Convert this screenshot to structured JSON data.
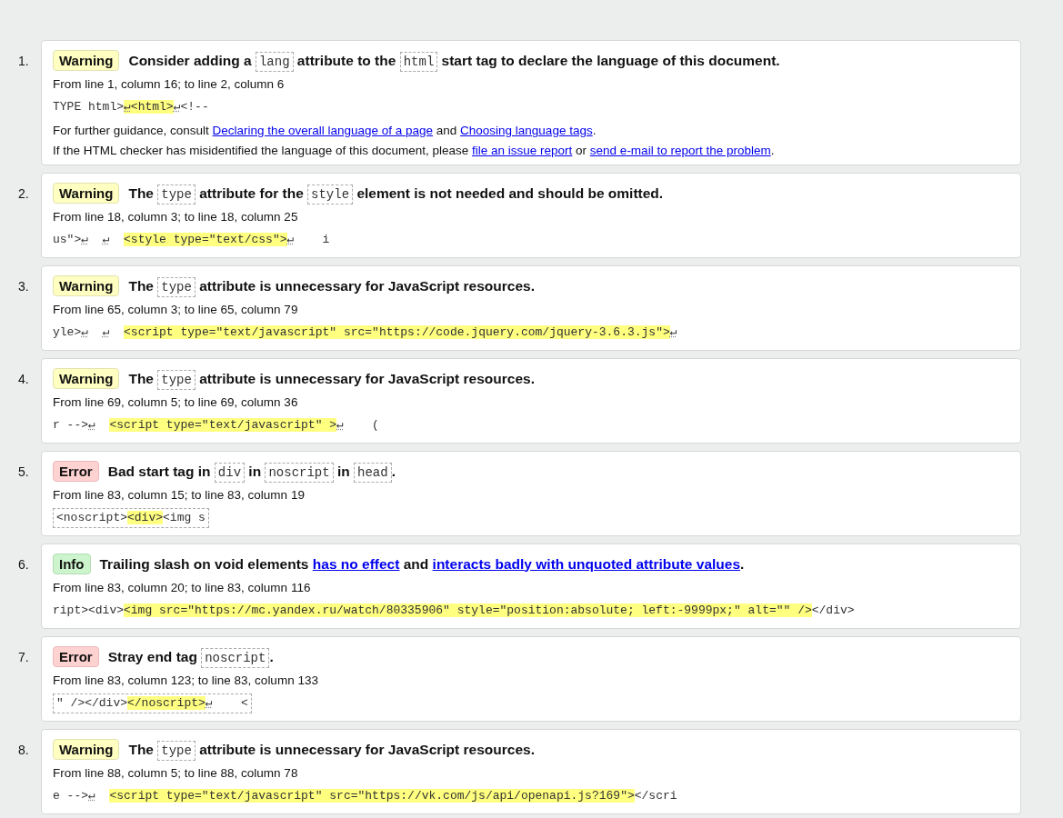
{
  "messages": [
    {
      "number": "1.",
      "kind": "warning",
      "badge": "Warning",
      "title": [
        {
          "kind": "text",
          "text": "Consider adding a "
        },
        {
          "kind": "code",
          "text": "lang"
        },
        {
          "kind": "text",
          "text": " attribute to the "
        },
        {
          "kind": "code",
          "text": "html"
        },
        {
          "kind": "text",
          "text": " start tag to declare the language of this document."
        }
      ],
      "location": "From line 1, column 16; to line 2, column 6",
      "extract": {
        "boxed": false,
        "parts": [
          {
            "kind": "text",
            "text": "TYPE html>",
            "highlight": false
          },
          {
            "kind": "lf",
            "text": "↵",
            "highlight": true
          },
          {
            "kind": "text",
            "text": "<html>",
            "highlight": true
          },
          {
            "kind": "lf",
            "text": "↵",
            "highlight": false
          },
          {
            "kind": "text",
            "text": "<!--",
            "highlight": false
          }
        ]
      },
      "notes": [
        [
          {
            "kind": "text",
            "text": "For further guidance, consult "
          },
          {
            "kind": "link",
            "text": "Declaring the overall language of a page"
          },
          {
            "kind": "text",
            "text": " and "
          },
          {
            "kind": "link",
            "text": "Choosing language tags"
          },
          {
            "kind": "text",
            "text": "."
          }
        ],
        [
          {
            "kind": "text",
            "text": "If the HTML checker has misidentified the language of this document, please "
          },
          {
            "kind": "link",
            "text": "file an issue report"
          },
          {
            "kind": "text",
            "text": " or "
          },
          {
            "kind": "link",
            "text": "send e-mail to report the problem"
          },
          {
            "kind": "text",
            "text": "."
          }
        ]
      ]
    },
    {
      "number": "2.",
      "kind": "warning",
      "badge": "Warning",
      "title": [
        {
          "kind": "text",
          "text": "The "
        },
        {
          "kind": "code",
          "text": "type"
        },
        {
          "kind": "text",
          "text": " attribute for the "
        },
        {
          "kind": "code",
          "text": "style"
        },
        {
          "kind": "text",
          "text": " element is not needed and should be omitted."
        }
      ],
      "location": "From line 18, column 3; to line 18, column 25",
      "extract": {
        "boxed": false,
        "parts": [
          {
            "kind": "text",
            "text": "us\">",
            "highlight": false
          },
          {
            "kind": "lf",
            "text": "↵",
            "highlight": false
          },
          {
            "kind": "lf",
            "text": "↵",
            "highlight": false
          },
          {
            "kind": "text",
            "text": "<style type=\"text/css\">",
            "highlight": true
          },
          {
            "kind": "lf",
            "text": "↵",
            "highlight": false
          },
          {
            "kind": "text",
            "text": "    i",
            "highlight": false
          }
        ]
      }
    },
    {
      "number": "3.",
      "kind": "warning",
      "badge": "Warning",
      "title": [
        {
          "kind": "text",
          "text": "The "
        },
        {
          "kind": "code",
          "text": "type"
        },
        {
          "kind": "text",
          "text": " attribute is unnecessary for JavaScript resources."
        }
      ],
      "location": "From line 65, column 3; to line 65, column 79",
      "extract": {
        "boxed": false,
        "parts": [
          {
            "kind": "text",
            "text": "yle>",
            "highlight": false
          },
          {
            "kind": "lf",
            "text": "↵",
            "highlight": false
          },
          {
            "kind": "lf",
            "text": "↵",
            "highlight": false
          },
          {
            "kind": "text",
            "text": "<script type=\"text/javascript\" src=\"https://code.jquery.com/jquery-3.6.3.js\">",
            "highlight": true
          },
          {
            "kind": "lf",
            "text": "↵",
            "highlight": false
          }
        ]
      }
    },
    {
      "number": "4.",
      "kind": "warning",
      "badge": "Warning",
      "title": [
        {
          "kind": "text",
          "text": "The "
        },
        {
          "kind": "code",
          "text": "type"
        },
        {
          "kind": "text",
          "text": " attribute is unnecessary for JavaScript resources."
        }
      ],
      "location": "From line 69, column 5; to line 69, column 36",
      "extract": {
        "boxed": false,
        "parts": [
          {
            "kind": "text",
            "text": "r -->",
            "highlight": false
          },
          {
            "kind": "lf",
            "text": "↵",
            "highlight": false
          },
          {
            "kind": "text",
            "text": "<script type=\"text/javascript\" >",
            "highlight": true
          },
          {
            "kind": "lf",
            "text": "↵",
            "highlight": false
          },
          {
            "kind": "text",
            "text": "    (",
            "highlight": false
          }
        ]
      }
    },
    {
      "number": "5.",
      "kind": "error",
      "badge": "Error",
      "title": [
        {
          "kind": "text",
          "text": "Bad start tag in "
        },
        {
          "kind": "code",
          "text": "div"
        },
        {
          "kind": "text",
          "text": " in "
        },
        {
          "kind": "code",
          "text": "noscript"
        },
        {
          "kind": "text",
          "text": " in "
        },
        {
          "kind": "code",
          "text": "head"
        },
        {
          "kind": "text",
          "text": "."
        }
      ],
      "location": "From line 83, column 15; to line 83, column 19",
      "extract": {
        "boxed": true,
        "parts": [
          {
            "kind": "text",
            "text": "<noscript>",
            "highlight": false
          },
          {
            "kind": "text",
            "text": "<div>",
            "highlight": true
          },
          {
            "kind": "text",
            "text": "<img s",
            "highlight": false
          }
        ]
      }
    },
    {
      "number": "6.",
      "kind": "info",
      "badge": "Info",
      "title": [
        {
          "kind": "text",
          "text": "Trailing slash on void elements "
        },
        {
          "kind": "link",
          "text": "has no effect"
        },
        {
          "kind": "text",
          "text": " and "
        },
        {
          "kind": "link",
          "text": "interacts badly with unquoted attribute values"
        },
        {
          "kind": "text",
          "text": "."
        }
      ],
      "location": "From line 83, column 20; to line 83, column 116",
      "extract": {
        "boxed": false,
        "parts": [
          {
            "kind": "text",
            "text": "ript><div>",
            "highlight": false
          },
          {
            "kind": "text",
            "text": "<img src=\"https://mc.yandex.ru/watch/80335906\" style=\"position:absolute; left:-9999px;\" alt=\"\" />",
            "highlight": true
          },
          {
            "kind": "text",
            "text": "</div>",
            "highlight": false
          }
        ]
      }
    },
    {
      "number": "7.",
      "kind": "error",
      "badge": "Error",
      "title": [
        {
          "kind": "text",
          "text": "Stray end tag "
        },
        {
          "kind": "code",
          "text": "noscript"
        },
        {
          "kind": "text",
          "text": "."
        }
      ],
      "location": "From line 83, column 123; to line 83, column 133",
      "extract": {
        "boxed": true,
        "parts": [
          {
            "kind": "text",
            "text": "\" /></div>",
            "highlight": false
          },
          {
            "kind": "text",
            "text": "</noscript>",
            "highlight": true
          },
          {
            "kind": "lf",
            "text": "↵",
            "highlight": false
          },
          {
            "kind": "text",
            "text": "    <",
            "highlight": false
          }
        ]
      }
    },
    {
      "number": "8.",
      "kind": "warning",
      "badge": "Warning",
      "title": [
        {
          "kind": "text",
          "text": "The "
        },
        {
          "kind": "code",
          "text": "type"
        },
        {
          "kind": "text",
          "text": " attribute is unnecessary for JavaScript resources."
        }
      ],
      "location": "From line 88, column 5; to line 88, column 78",
      "extract": {
        "boxed": false,
        "parts": [
          {
            "kind": "text",
            "text": "e -->",
            "highlight": false
          },
          {
            "kind": "lf",
            "text": "↵",
            "highlight": false
          },
          {
            "kind": "text",
            "text": "<script type=\"text/javascript\" src=\"https://vk.com/js/api/openapi.js?169\">",
            "highlight": true
          },
          {
            "kind": "text",
            "text": "</scri",
            "highlight": false
          }
        ]
      }
    }
  ]
}
